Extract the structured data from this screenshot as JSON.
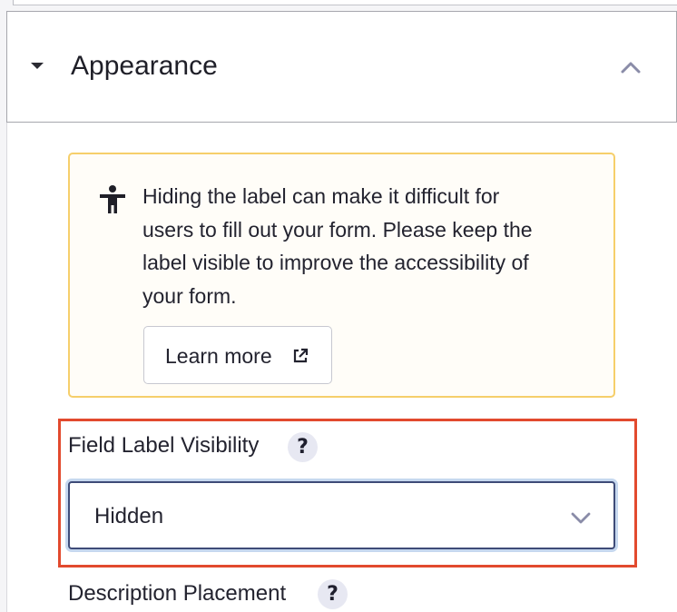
{
  "section": {
    "title": "Appearance"
  },
  "notice": {
    "line1": "Hiding the label can make it difficult for",
    "line2": "users to fill out your form. Please keep the",
    "line3": "label visible to improve the accessibility of",
    "line4": "your form.",
    "button_label": "Learn more"
  },
  "field_label_visibility": {
    "label": "Field Label Visibility",
    "help": "?",
    "selected": "Hidden"
  },
  "description_placement": {
    "label": "Description Placement",
    "help": "?"
  },
  "colors": {
    "highlight_border": "#e24a2e",
    "notice_border": "#f6cf6b",
    "select_border": "#3e4b78"
  },
  "icons": [
    "caret-down-icon",
    "chevron-up-icon",
    "accessibility-icon",
    "external-link-icon",
    "help-icon",
    "chevron-down-icon"
  ]
}
